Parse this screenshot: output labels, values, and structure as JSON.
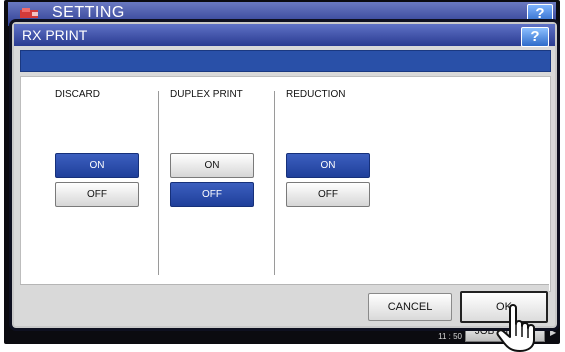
{
  "background": {
    "title": "SETTING",
    "help_label": "?",
    "clock_time": "11 : 50",
    "job_button_label": "JOB STATUS"
  },
  "dialog": {
    "title": "RX PRINT",
    "help_label": "?",
    "columns": [
      {
        "label": "DISCARD",
        "options": [
          {
            "label": "ON",
            "selected": true
          },
          {
            "label": "OFF",
            "selected": false
          }
        ]
      },
      {
        "label": "DUPLEX PRINT",
        "options": [
          {
            "label": "ON",
            "selected": false
          },
          {
            "label": "OFF",
            "selected": true
          }
        ]
      },
      {
        "label": "REDUCTION",
        "options": [
          {
            "label": "ON",
            "selected": true
          },
          {
            "label": "OFF",
            "selected": false
          }
        ]
      }
    ],
    "cancel_label": "CANCEL",
    "ok_label": "OK"
  },
  "colors": {
    "selected": "#2A4DAA",
    "title_bar": "#3A4FA8",
    "band": "#2950A8"
  },
  "icons": {
    "logo": "device-logo-icon",
    "cursor": "hand-pointer-icon"
  }
}
